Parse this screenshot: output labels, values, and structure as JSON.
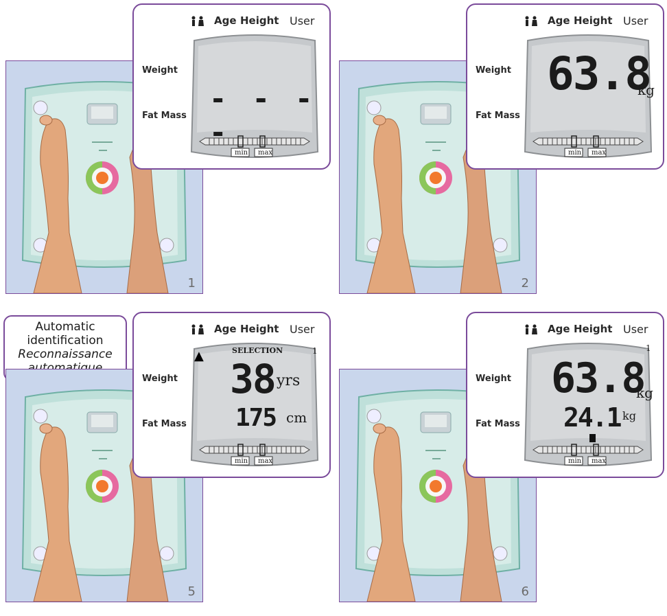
{
  "header": {
    "age": "Age",
    "height": "Height",
    "user": "User"
  },
  "labels": {
    "weight": "Weight",
    "fat_mass": "Fat Mass"
  },
  "bar_labels": {
    "min": "min",
    "max": "max"
  },
  "badge": {
    "line1": "Automatic",
    "line2": "identification",
    "line3": "Reconnaissance",
    "line4": "automatique"
  },
  "panels": [
    {
      "number": "1",
      "main": "- - - -",
      "main_unit": "",
      "second": "",
      "second_unit": "",
      "selection": "",
      "user_digit": "",
      "tiny": "----"
    },
    {
      "number": "2",
      "main": "63.8",
      "main_unit": "kg",
      "second": "",
      "second_unit": "",
      "selection": "",
      "user_digit": "",
      "tiny": "63.8"
    },
    {
      "number": "5",
      "main": "38",
      "main_unit": "yrs",
      "second": "175",
      "second_unit": "cm",
      "selection": "SELECTION",
      "user_digit": "1",
      "tiny": "38"
    },
    {
      "number": "6",
      "main": "63.8",
      "main_unit": "kg",
      "second": "24.1",
      "second_unit": "kg",
      "selection": "",
      "user_digit": "1",
      "tiny": "63.8"
    }
  ]
}
